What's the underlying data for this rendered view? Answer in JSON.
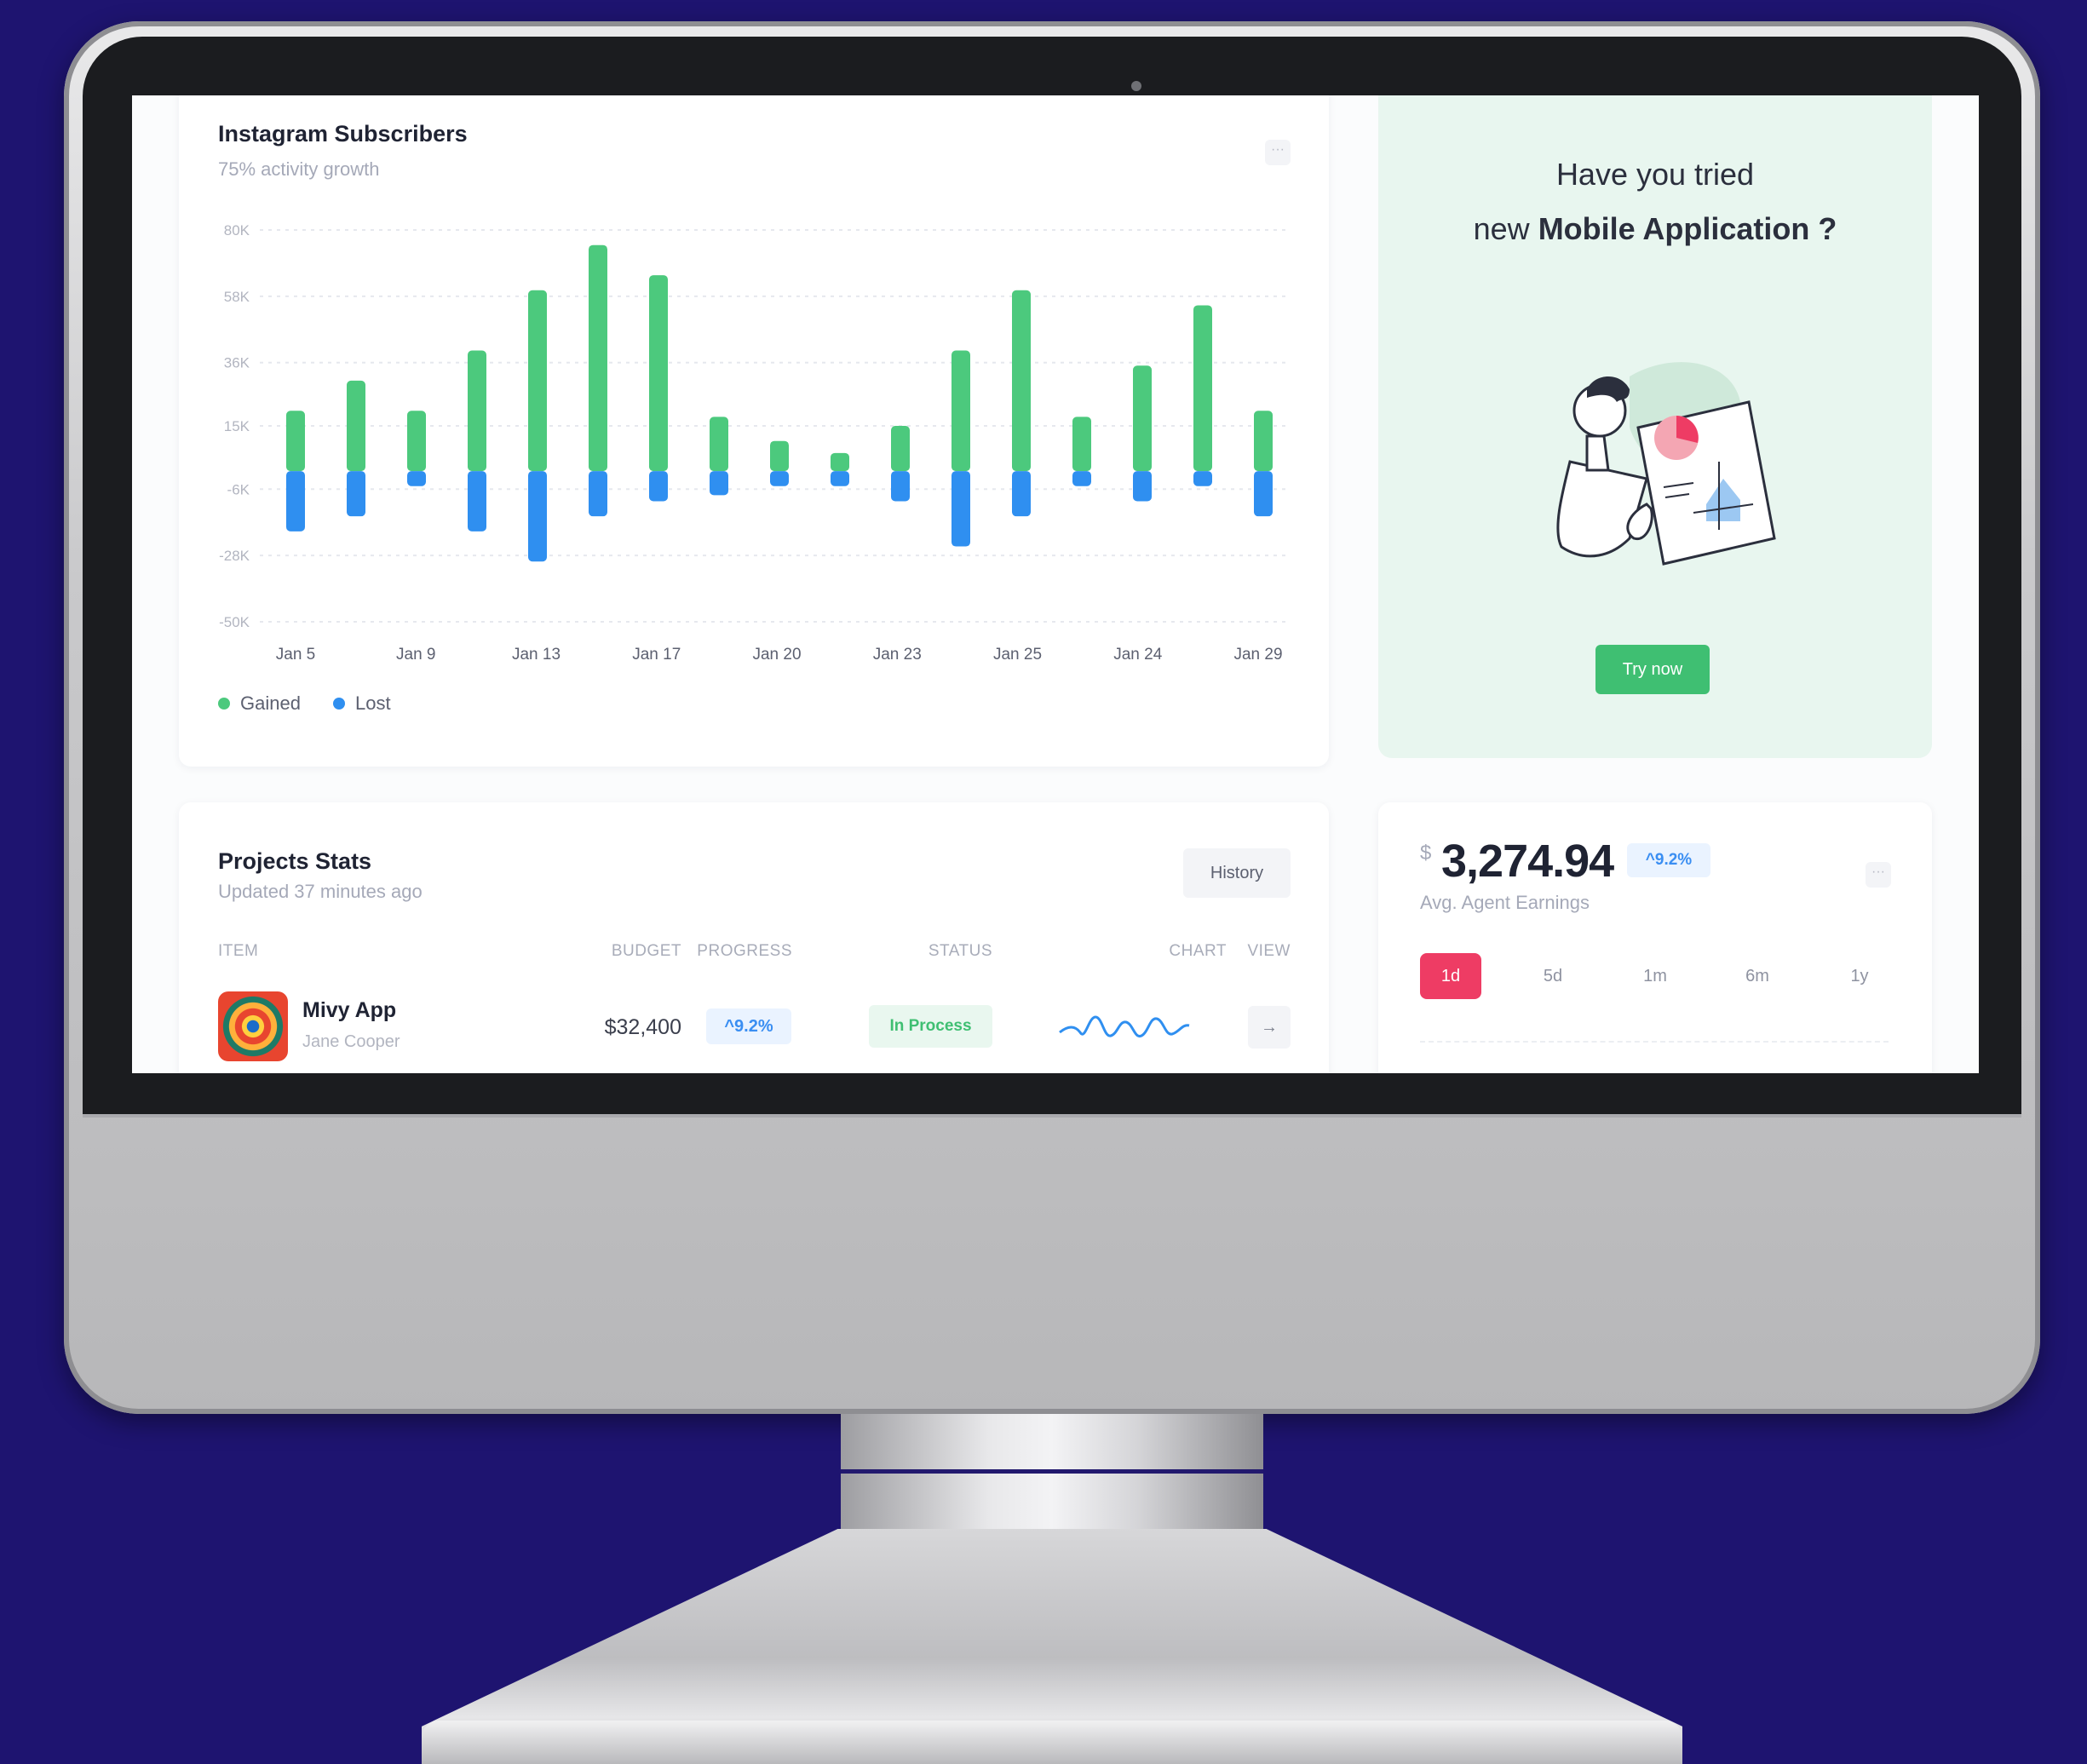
{
  "subscribers_card": {
    "title": "Instagram Subscribers",
    "subtitle": "75% activity growth",
    "menu_icon": "more-dots-icon",
    "legend": [
      {
        "label": "Gained",
        "color": "#4cc97d"
      },
      {
        "label": "Lost",
        "color": "#2f8ff0"
      }
    ]
  },
  "chart_data": {
    "type": "bar",
    "stacked": true,
    "y_tick_labels": [
      "80K",
      "58K",
      "36K",
      "15K",
      "-6K",
      "-28K",
      "-50K"
    ],
    "y_tick_values": [
      80,
      58,
      36,
      15,
      -6,
      -28,
      -50
    ],
    "x_tick_labels": [
      "Jan 5",
      "Jan 9",
      "Jan 13",
      "Jan 17",
      "Jan 20",
      "Jan 23",
      "Jan 25",
      "Jan 24",
      "Jan 29"
    ],
    "ylim": [
      -50,
      80
    ],
    "grid": true,
    "legend_position": "bottom-left",
    "series": [
      {
        "name": "Gained",
        "color": "#4cc97d",
        "values": [
          20,
          30,
          20,
          40,
          60,
          75,
          65,
          18,
          10,
          6,
          15,
          40,
          60,
          18,
          35,
          55,
          20
        ]
      },
      {
        "name": "Lost",
        "color": "#2f8ff0",
        "values": [
          -20,
          -15,
          -5,
          -20,
          -30,
          -15,
          -10,
          -8,
          -5,
          -5,
          -10,
          -25,
          -15,
          -5,
          -10,
          -5,
          -15
        ]
      }
    ]
  },
  "promo": {
    "line1": "Have you tried",
    "line2_prefix": "new ",
    "line2_bold": "Mobile Application ?",
    "button": "Try now",
    "illustration": "person-with-chart-illustration"
  },
  "projects": {
    "title": "Projects Stats",
    "subtitle": "Updated 37 minutes ago",
    "history_button": "History",
    "columns": [
      "ITEM",
      "BUDGET",
      "PROGRESS",
      "STATUS",
      "CHART",
      "VIEW"
    ],
    "rows": [
      {
        "name": "Mivy App",
        "owner": "Jane Cooper",
        "budget": "$32,400",
        "progress": "9.2%",
        "status": "In Process",
        "view_icon": "arrow-right-icon"
      }
    ]
  },
  "earnings": {
    "currency": "$",
    "amount": "3,274.94",
    "change": "9.2%",
    "label": "Avg. Agent Earnings",
    "ranges": [
      "1d",
      "5d",
      "1m",
      "6m",
      "1y"
    ],
    "active_range": "1d"
  },
  "colors": {
    "background": "#1e1470",
    "gained": "#4cc97d",
    "lost": "#2f8ff0",
    "accent_red": "#ee3c64",
    "promo_bg": "#e8f6ef"
  }
}
